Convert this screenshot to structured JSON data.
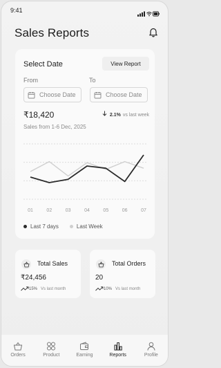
{
  "status": {
    "time": "9:41"
  },
  "page": {
    "title": "Sales Reports"
  },
  "date_card": {
    "title": "Select Date",
    "view_label": "View Report",
    "from_label": "From",
    "to_label": "To",
    "from_placeholder": "Choose Date",
    "to_placeholder": "Choose Date",
    "amount": "₹18,420",
    "delta_pct": "2.1%",
    "delta_text": "vs last week",
    "subtitle": "Sales from 1-6 Dec, 2025"
  },
  "chart_data": {
    "type": "line",
    "categories": [
      "01",
      "02",
      "03",
      "04",
      "05",
      "06",
      "07"
    ],
    "series": [
      {
        "name": "Last 7 days",
        "values": [
          2.0,
          1.5,
          1.8,
          3.0,
          2.8,
          1.6,
          4.0
        ]
      },
      {
        "name": "Last Week",
        "values": [
          2.5,
          3.4,
          2.1,
          3.3,
          2.7,
          3.4,
          2.8
        ]
      }
    ],
    "ylim": [
      0,
      5
    ],
    "grid": true,
    "legend": "bottom-left",
    "colors": {
      "Last 7 days": "#2b2b2b",
      "Last Week": "#cfcfcf"
    }
  },
  "stats": [
    {
      "title": "Total Sales",
      "value": "₹24,456",
      "pct": "15%",
      "vs": "Vs last month",
      "icon": "basket-icon"
    },
    {
      "title": "Total Orders",
      "value": "20",
      "pct": "10%",
      "vs": "Vs last month",
      "icon": "basket-icon"
    }
  ],
  "nav": [
    {
      "label": "Orders",
      "icon": "basket-icon"
    },
    {
      "label": "Product",
      "icon": "grid-icon"
    },
    {
      "label": "Earning",
      "icon": "wallet-icon"
    },
    {
      "label": "Reports",
      "icon": "bar-chart-icon",
      "active": true
    },
    {
      "label": "Profile",
      "icon": "user-icon"
    }
  ]
}
